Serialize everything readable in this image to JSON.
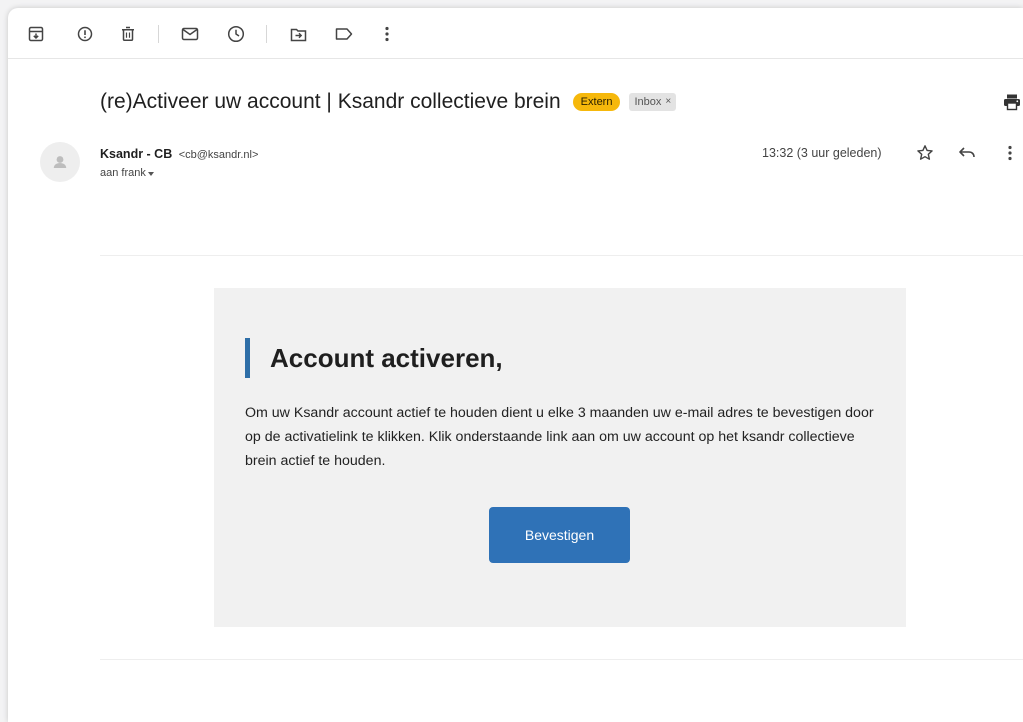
{
  "email": {
    "subject": "(re)Activeer uw account | Ksandr collectieve brein",
    "labels": {
      "extern": "Extern",
      "inbox": "Inbox",
      "inbox_remove": "×"
    },
    "sender": {
      "name": "Ksandr - CB",
      "email": "<cb@ksandr.nl>",
      "to": "aan frank"
    },
    "time": "13:32 (3 uur geleden)"
  },
  "body_card": {
    "title": "Account activeren,",
    "text": "Om uw Ksandr account actief te houden dient u elke 3 maanden uw e-mail adres te bevestigen door op de activatielink te klikken. Klik onderstaande link aan om uw account op het ksandr collectieve brein actief te houden.",
    "button_label": "Bevestigen"
  },
  "colors": {
    "extern_badge": "#f6b80b",
    "accent_bar": "#2e6ea7",
    "button": "#2f72b7",
    "card_background": "#f1f1f1"
  },
  "toolbar_icons": [
    "archive-icon",
    "report-spam-icon",
    "delete-icon",
    "mark-unread-icon",
    "snooze-icon",
    "move-to-icon",
    "label-icon",
    "more-vertical-icon"
  ],
  "header_icons": [
    "print-icon",
    "star-icon",
    "reply-icon",
    "more-vertical-icon"
  ]
}
